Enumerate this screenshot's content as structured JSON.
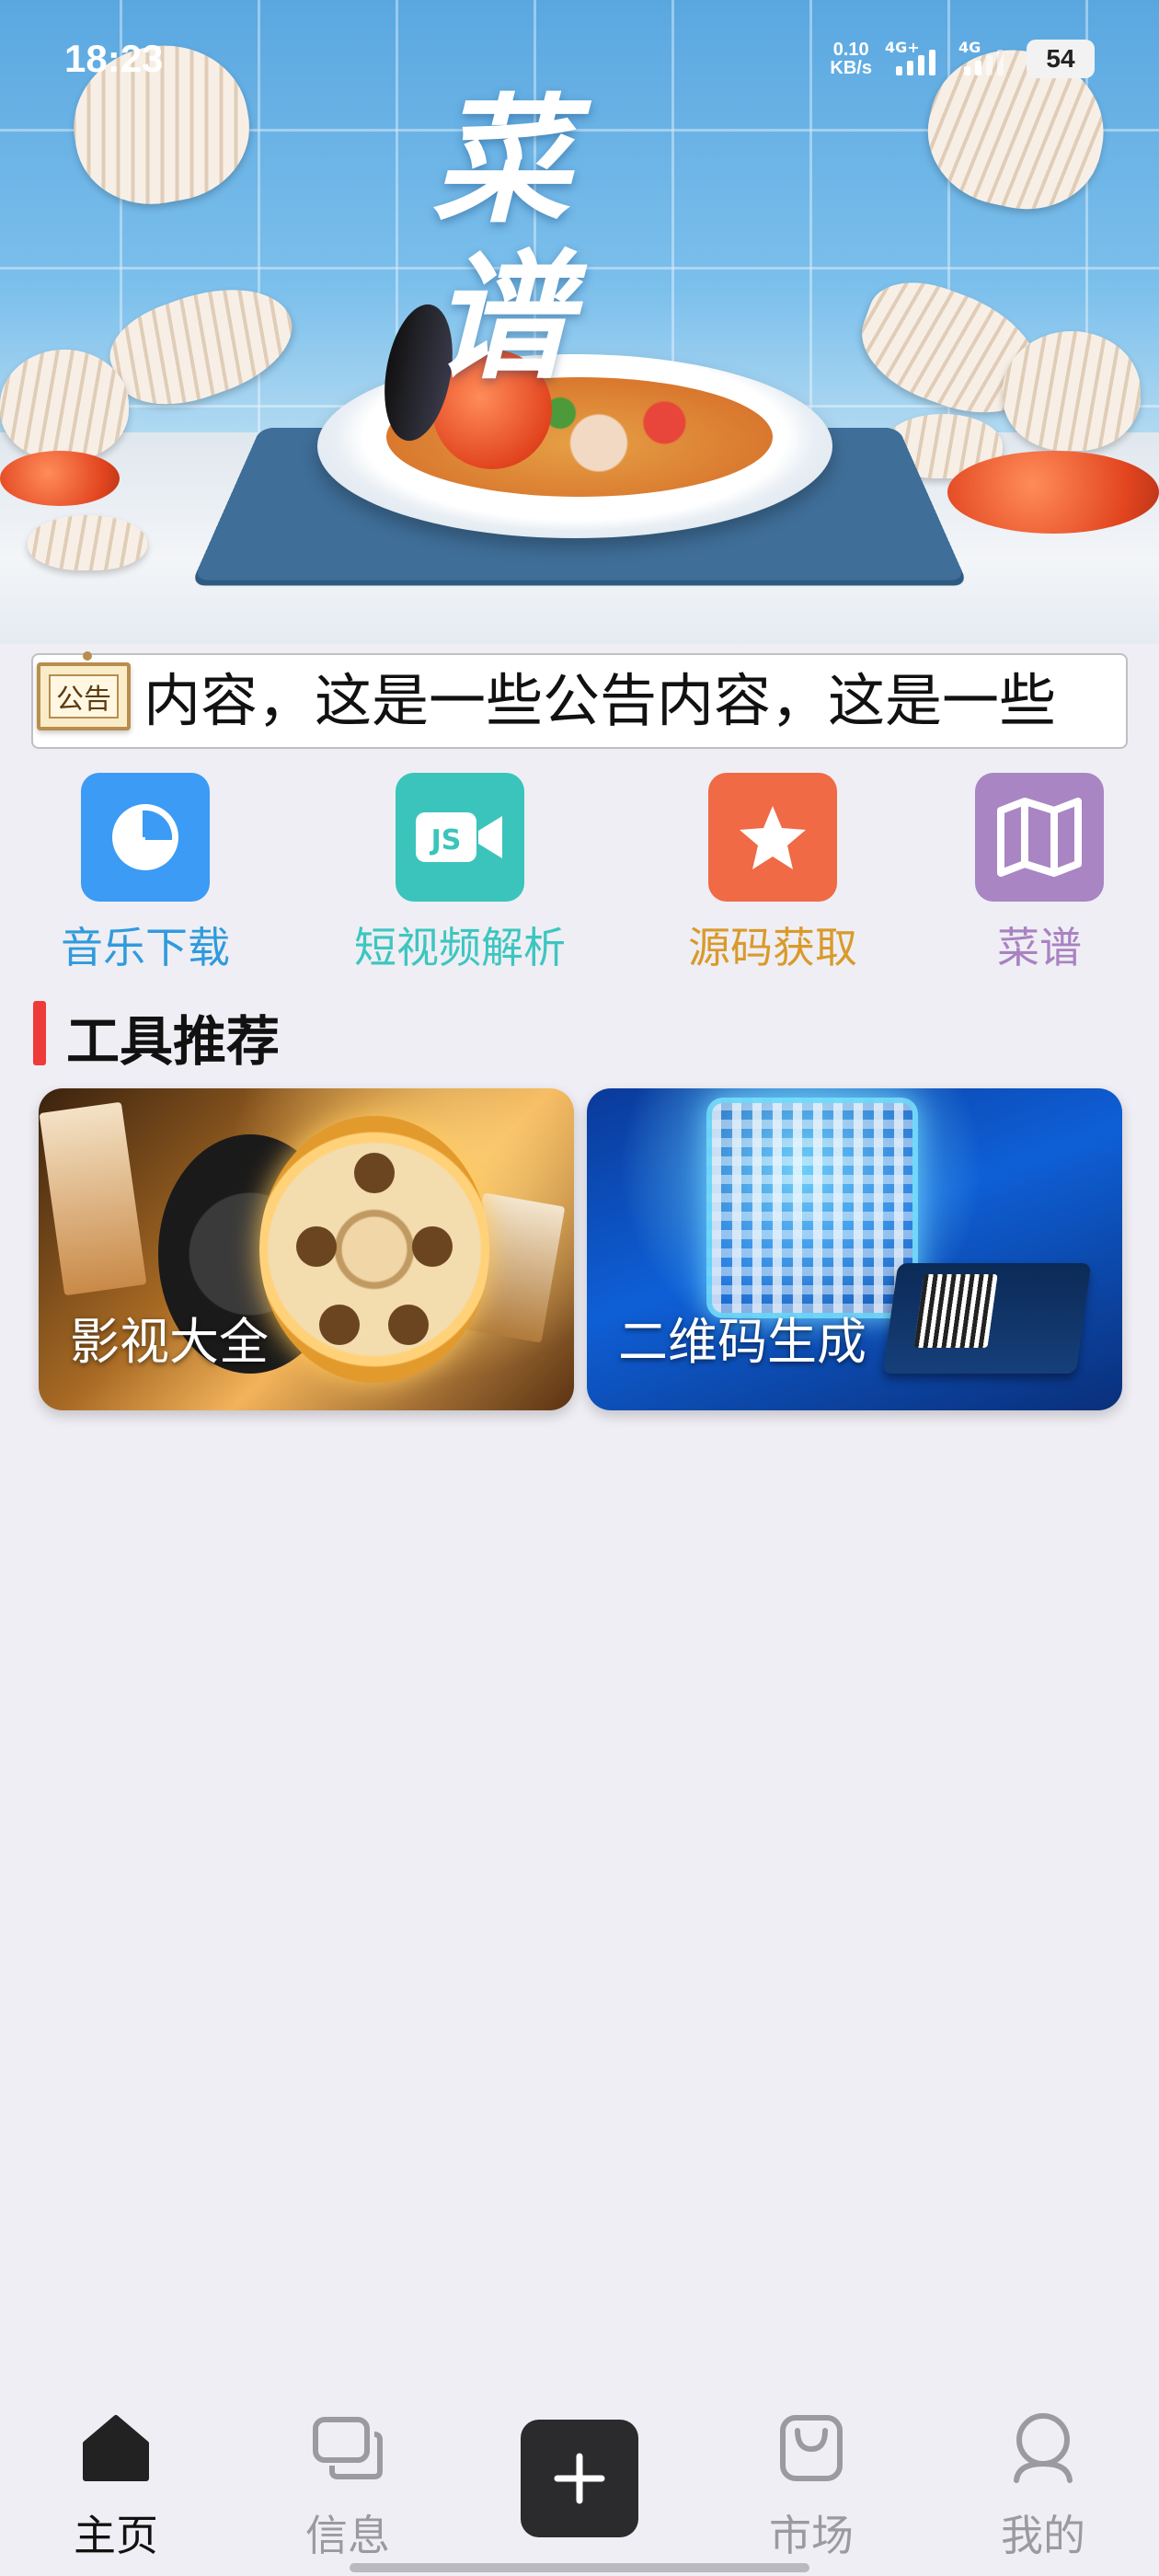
{
  "status_bar": {
    "time": "18:23",
    "net_speed_value": "0.10",
    "net_speed_unit": "KB/s",
    "sim1_tag": "4G+",
    "sim2_tag": "4G",
    "battery": "54"
  },
  "hero": {
    "title": "菜谱"
  },
  "notice": {
    "badge": "公告",
    "text": "内容，这是一些公告内容，这是一些"
  },
  "quick_actions": [
    {
      "label": "音乐下载",
      "icon": "pie-clock-icon",
      "color": "#3b9bf5",
      "label_color": "#2f9bdc"
    },
    {
      "label": "短视频解析",
      "icon": "js-video-icon",
      "color": "#3ac4bc",
      "label_color": "#3cc6c0"
    },
    {
      "label": "源码获取",
      "icon": "star-icon",
      "color": "#ef6a45",
      "label_color": "#d99a2b"
    },
    {
      "label": "菜谱",
      "icon": "map-icon",
      "color": "#a985c4",
      "label_color": "#a982c2"
    }
  ],
  "section": {
    "title": "工具推荐",
    "accent": "#ef3a3a"
  },
  "tools": [
    {
      "label": "影视大全",
      "icon": "film-reel-icon"
    },
    {
      "label": "二维码生成",
      "icon": "qr-code-icon"
    }
  ],
  "nav": {
    "items": [
      {
        "label": "主页",
        "icon": "home-icon",
        "active": true
      },
      {
        "label": "信息",
        "icon": "chat-icon",
        "active": false
      },
      {
        "label": "市场",
        "icon": "shopping-bag-icon",
        "active": false
      },
      {
        "label": "我的",
        "icon": "user-icon",
        "active": false
      }
    ],
    "center_icon": "plus-icon"
  }
}
